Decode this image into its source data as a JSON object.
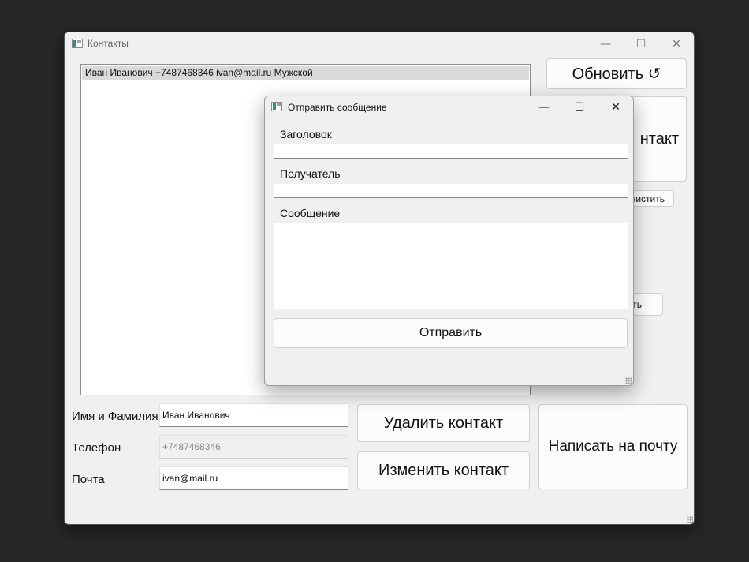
{
  "main_window": {
    "title": "Контакты",
    "controls": {
      "minimize": "—",
      "maximize": "☐",
      "close": "✕"
    }
  },
  "contacts_list": {
    "items": [
      "Иван Иванович +7487468346 ivan@mail.ru Мужской"
    ]
  },
  "buttons": {
    "refresh": "Обновить ↺",
    "add_contact_partial": "нтакт",
    "clear_partial": "чистить",
    "hidden_partial": "ть",
    "delete_contact": "Удалить контакт",
    "edit_contact": "Изменить контакт",
    "write_email": "Написать на почту"
  },
  "form": {
    "name_label": "Имя и Фамилия",
    "name_value": "Иван Иванович",
    "phone_label": "Телефон",
    "phone_value": "+7487468346",
    "email_label": "Почта",
    "email_value": "ivan@mail.ru"
  },
  "dialog": {
    "title": "Отправить сообщение",
    "controls": {
      "minimize": "—",
      "maximize": "☐",
      "close": "✕"
    },
    "subject_label": "Заголовок",
    "subject_value": "",
    "recipient_label": "Получатель",
    "recipient_value": "",
    "message_label": "Сообщение",
    "message_value": "",
    "send_button": "Отправить"
  }
}
